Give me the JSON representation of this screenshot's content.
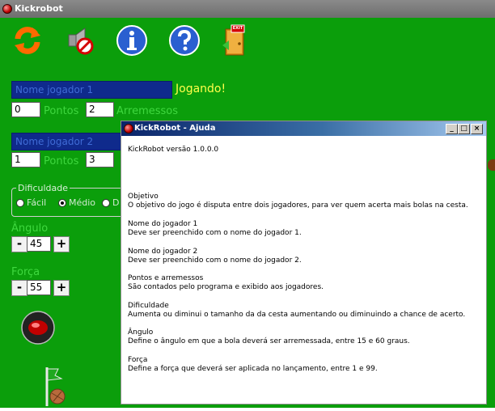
{
  "window": {
    "title": "Kickrobot"
  },
  "toolbar": {
    "icons": [
      "refresh-icon",
      "mute-icon",
      "info-icon",
      "help-icon",
      "exit-icon"
    ],
    "exit_sign": "EXIT"
  },
  "player1": {
    "name": "Nome jogador 1",
    "status": "Jogando!",
    "points": "0",
    "points_label": "Pontos",
    "throws": "2",
    "throws_label": "Arremessos"
  },
  "player2": {
    "name": "Nome jogador 2",
    "points": "1",
    "points_label": "Pontos",
    "throws": "3"
  },
  "difficulty": {
    "title": "Dificuldade",
    "options": [
      "Fácil",
      "Médio",
      "D"
    ],
    "selected": "Médio"
  },
  "angle": {
    "label": "Ângulo",
    "value": "45"
  },
  "force": {
    "label": "Força",
    "value": "55"
  },
  "stepper": {
    "minus": "-",
    "plus": "+"
  },
  "help": {
    "title": "KickRobot - Ajuda",
    "version": "KickRobot versão 1.0.0.0",
    "sections": [
      {
        "heading": "Objetivo",
        "text": "O objetivo do jogo é disputa entre dois jogadores, para ver quem acerta mais bolas na cesta."
      },
      {
        "heading": "Nome do jogador 1",
        "text": "Deve ser preenchido com o nome do jogador 1."
      },
      {
        "heading": "Nome do jogador 2",
        "text": "Deve ser preenchido com o nome do jogador 2."
      },
      {
        "heading": "Pontos e arremessos",
        "text": "São contados pelo programa e exibido aos jogadores."
      },
      {
        "heading": "Dificuldade",
        "text": "Aumenta ou diminui o tamanho da da cesta aumentando ou diminuindo a chance de acerto."
      },
      {
        "heading": "Ângulo",
        "text": "Define o ângulo em que a bola deverá ser arremessada, entre 15 e 60 graus."
      },
      {
        "heading": "Força",
        "text": "Define a força que deverá ser aplicada no lançamento, entre 1 e 99."
      }
    ],
    "buttons": {
      "minimize": "_",
      "maximize": "□",
      "close": "×"
    }
  },
  "colors": {
    "background": "#0b9e0b",
    "status_text": "#ffff4a",
    "name_field": "#0f2a8c",
    "dialog_title": "#0a246a"
  }
}
